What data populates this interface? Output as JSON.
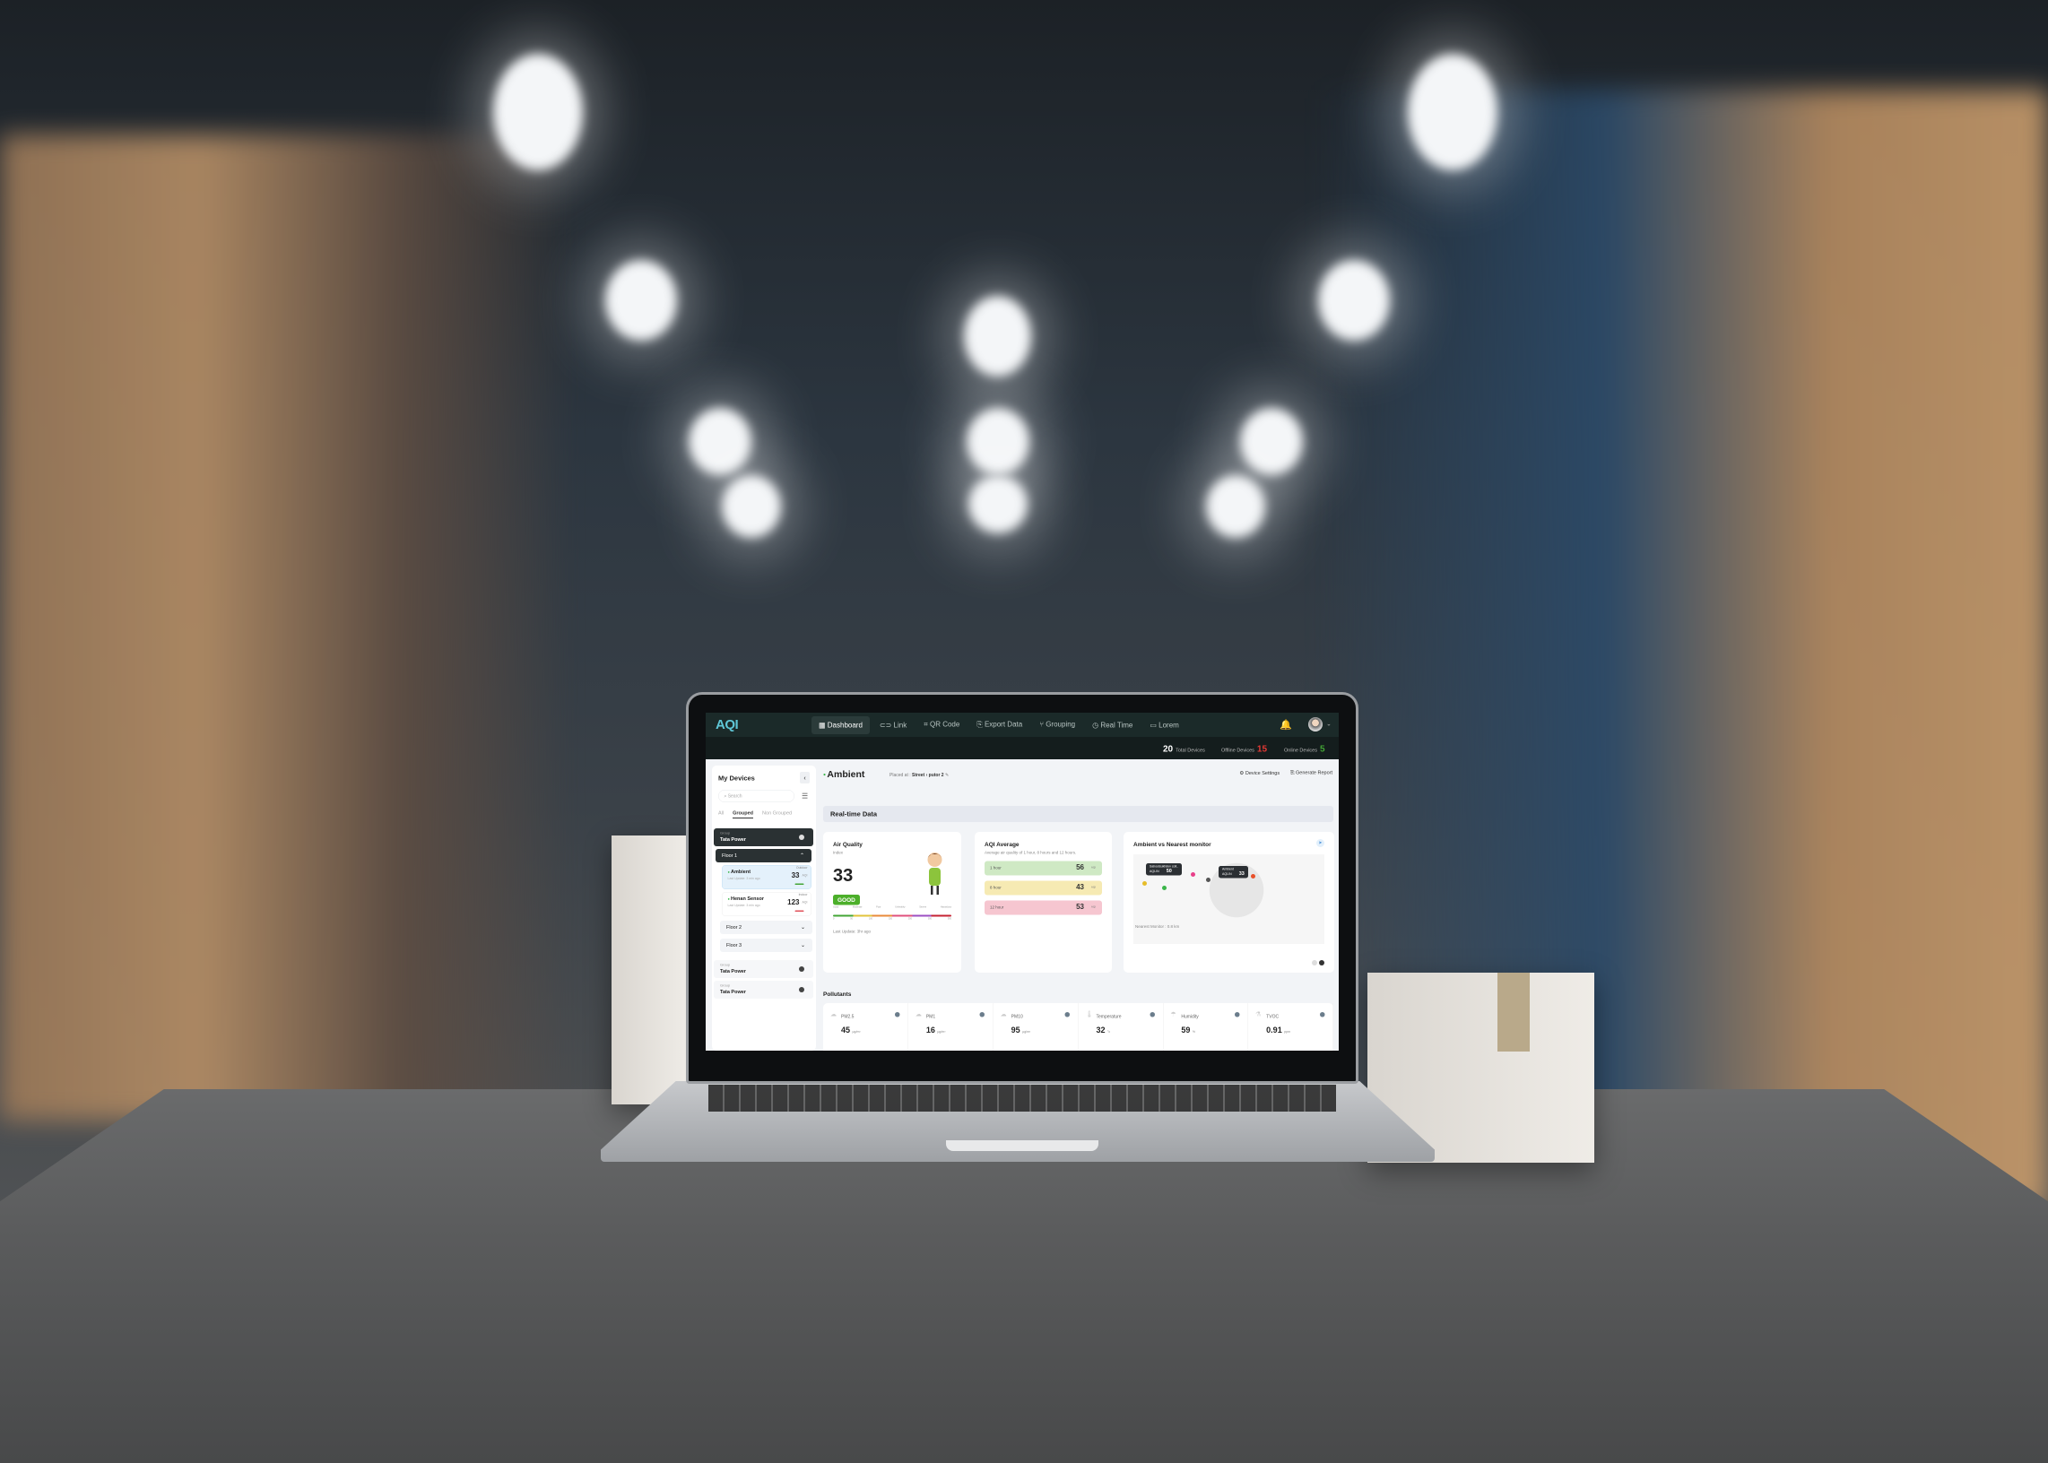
{
  "app": {
    "logo": "AQI"
  },
  "nav": {
    "items": [
      {
        "label": "Dashboard",
        "icon": "grid-icon",
        "active": true
      },
      {
        "label": "Link",
        "icon": "link-icon"
      },
      {
        "label": "QR Code",
        "icon": "qr-icon"
      },
      {
        "label": "Export Data",
        "icon": "export-icon"
      },
      {
        "label": "Grouping",
        "icon": "grouping-icon"
      },
      {
        "label": "Real Time",
        "icon": "clock-icon"
      },
      {
        "label": "Lorem",
        "icon": "window-icon"
      }
    ]
  },
  "stats": {
    "total_value": "20",
    "total_label": "Total Devices",
    "offline_label": "Offline Devices",
    "offline_value": "15",
    "online_label": "Online Devices",
    "online_value": "5",
    "offline_color": "#e53935",
    "online_color": "#43a535"
  },
  "sidebar": {
    "title": "My Devices",
    "search_placeholder": "Search",
    "tabs": [
      "All",
      "Grouped",
      "Non Grouped"
    ],
    "group_label": "Group",
    "group_name": "Tata Power",
    "floors": [
      "Floor 1",
      "Floor 2",
      "Floor 3"
    ],
    "devices": [
      {
        "tag": "Outdoor",
        "name": "Ambient",
        "value": "33",
        "unit": "AQI",
        "updated": "Last Update: 3 min ago"
      },
      {
        "tag": "Indoor",
        "name": "Henan Sensor",
        "value": "123",
        "unit": "AQI",
        "updated": "Last Update: 3 min ago"
      }
    ]
  },
  "header": {
    "title": "Ambient",
    "placed_label": "Placed at :",
    "placed_value": "Street › putor 2",
    "device_settings": "Device Settings",
    "generate_report": "Generate Report"
  },
  "realtime": {
    "title": "Real-time Data"
  },
  "air_quality": {
    "title": "Air Quality",
    "subtitle": "Index",
    "value": "33",
    "status": "GOOD",
    "scale_labels": [
      "Good",
      "Moderate",
      "Poor",
      "Unhealthy",
      "Severe",
      "Hazardous"
    ],
    "scale_ticks": [
      "0",
      "50",
      "100",
      "150",
      "200",
      "300",
      "500"
    ],
    "updated": "Last Update: 3hr ago"
  },
  "aqi_average": {
    "title": "AQI Average",
    "desc": "Average air quality of 1 hour, 8 hours and 12 hours.",
    "rows": [
      {
        "label": "1 hour",
        "value": "56",
        "unit": "AQI",
        "color": "#cfe9c4"
      },
      {
        "label": "8 hour",
        "value": "43",
        "unit": "AQI",
        "color": "#f6eab3"
      },
      {
        "label": "12 hour",
        "value": "53",
        "unit": "AQI",
        "color": "#f6c6d0"
      }
    ]
  },
  "monitor": {
    "title": "Ambient vs Nearest monitor",
    "tip1_name": "Sahoolsukhdev coll..",
    "tip1_label": "AQI-IN",
    "tip1_value": "50",
    "tip2_name": "Ambient",
    "tip2_label": "AQI-IN",
    "tip2_value": "33",
    "nearest": "Nearest Monitor : 0.8 km"
  },
  "pollutants": {
    "title": "Pollutants",
    "items": [
      {
        "name": "PM2.5",
        "value": "45",
        "unit": "µg/m³"
      },
      {
        "name": "PM1",
        "value": "16",
        "unit": "µg/m³"
      },
      {
        "name": "PM10",
        "value": "95",
        "unit": "µg/m³"
      },
      {
        "name": "Temperature",
        "value": "32",
        "unit": "°c"
      },
      {
        "name": "Humidity",
        "value": "59",
        "unit": "%"
      },
      {
        "name": "TVOC",
        "value": "0.91",
        "unit": "ppm"
      }
    ]
  }
}
